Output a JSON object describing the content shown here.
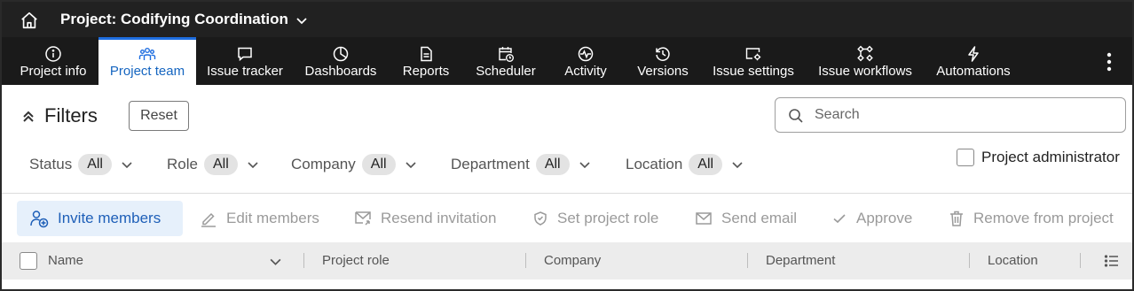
{
  "header": {
    "project_label": "Project:",
    "project_name": "Codifying Coordination",
    "home_icon": "home-icon",
    "dropdown_icon": "chevron-down-icon"
  },
  "nav": {
    "tabs": [
      {
        "label": "Project info",
        "icon": "info-icon",
        "active": false
      },
      {
        "label": "Project team",
        "icon": "team-icon",
        "active": true
      },
      {
        "label": "Issue tracker",
        "icon": "chat-icon",
        "active": false
      },
      {
        "label": "Dashboards",
        "icon": "pie-chart-icon",
        "active": false
      },
      {
        "label": "Reports",
        "icon": "document-icon",
        "active": false
      },
      {
        "label": "Scheduler",
        "icon": "calendar-clock-icon",
        "active": false
      },
      {
        "label": "Activity",
        "icon": "pulse-icon",
        "active": false
      },
      {
        "label": "Versions",
        "icon": "history-icon",
        "active": false
      },
      {
        "label": "Issue settings",
        "icon": "issue-settings-icon",
        "active": false
      },
      {
        "label": "Issue workflows",
        "icon": "workflow-icon",
        "active": false
      },
      {
        "label": "Automations",
        "icon": "lightning-icon",
        "active": false
      }
    ],
    "more_icon": "more-vertical-icon",
    "accent": "#1e6ee0"
  },
  "filters": {
    "title": "Filters",
    "reset_label": "Reset",
    "search_placeholder": "Search",
    "groups": [
      {
        "label": "Status",
        "value": "All"
      },
      {
        "label": "Role",
        "value": "All"
      },
      {
        "label": "Company",
        "value": "All"
      },
      {
        "label": "Department",
        "value": "All"
      },
      {
        "label": "Location",
        "value": "All"
      }
    ],
    "admin_label": "Project administrator",
    "admin_checked": false
  },
  "actions": {
    "invite": "Invite members",
    "edit": "Edit members",
    "resend": "Resend invitation",
    "set_role": "Set project role",
    "send_email": "Send email",
    "approve": "Approve",
    "remove": "Remove from project"
  },
  "table": {
    "columns": [
      "Name",
      "Project role",
      "Company",
      "Department",
      "Location"
    ]
  }
}
